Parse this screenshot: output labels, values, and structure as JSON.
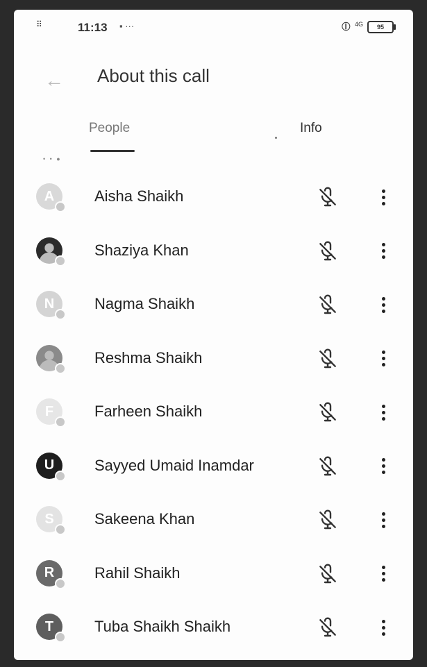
{
  "status_bar": {
    "time": "11:13",
    "notification_icons": "▪ ···",
    "network_label": "4G",
    "battery_level": "95"
  },
  "app_bar": {
    "back_glyph": "←",
    "title": "About this call"
  },
  "tabs": [
    {
      "label": "People",
      "selected": true
    },
    {
      "label": "Info",
      "selected": false
    }
  ],
  "participants": [
    {
      "name": "Aisha Shaikh",
      "initial": "A",
      "avatar_color": "#d9d9d9",
      "avatar_type": "initial"
    },
    {
      "name": "Shaziya Khan",
      "initial": "",
      "avatar_color": "#2b2b2b",
      "avatar_type": "photo"
    },
    {
      "name": "Nagma Shaikh",
      "initial": "N",
      "avatar_color": "#d4d4d4",
      "avatar_type": "initial"
    },
    {
      "name": "Reshma Shaikh",
      "initial": "",
      "avatar_color": "#8a8a8a",
      "avatar_type": "photo"
    },
    {
      "name": "Farheen Shaikh",
      "initial": "F",
      "avatar_color": "#e6e6e6",
      "avatar_type": "initial"
    },
    {
      "name": "Sayyed Umaid Inamdar",
      "initial": "U",
      "avatar_color": "#1e1e1e",
      "avatar_type": "initial"
    },
    {
      "name": "Sakeena Khan",
      "initial": "S",
      "avatar_color": "#e3e3e3",
      "avatar_type": "initial"
    },
    {
      "name": "Rahil Shaikh",
      "initial": "R",
      "avatar_color": "#6a6a6a",
      "avatar_type": "initial"
    },
    {
      "name": "Tuba Shaikh Shaikh",
      "initial": "T",
      "avatar_color": "#5e5e5e",
      "avatar_type": "initial"
    }
  ],
  "icons": {
    "mic": "mic-off-icon",
    "more": "more-vert-icon",
    "back": "arrow-back-icon"
  }
}
